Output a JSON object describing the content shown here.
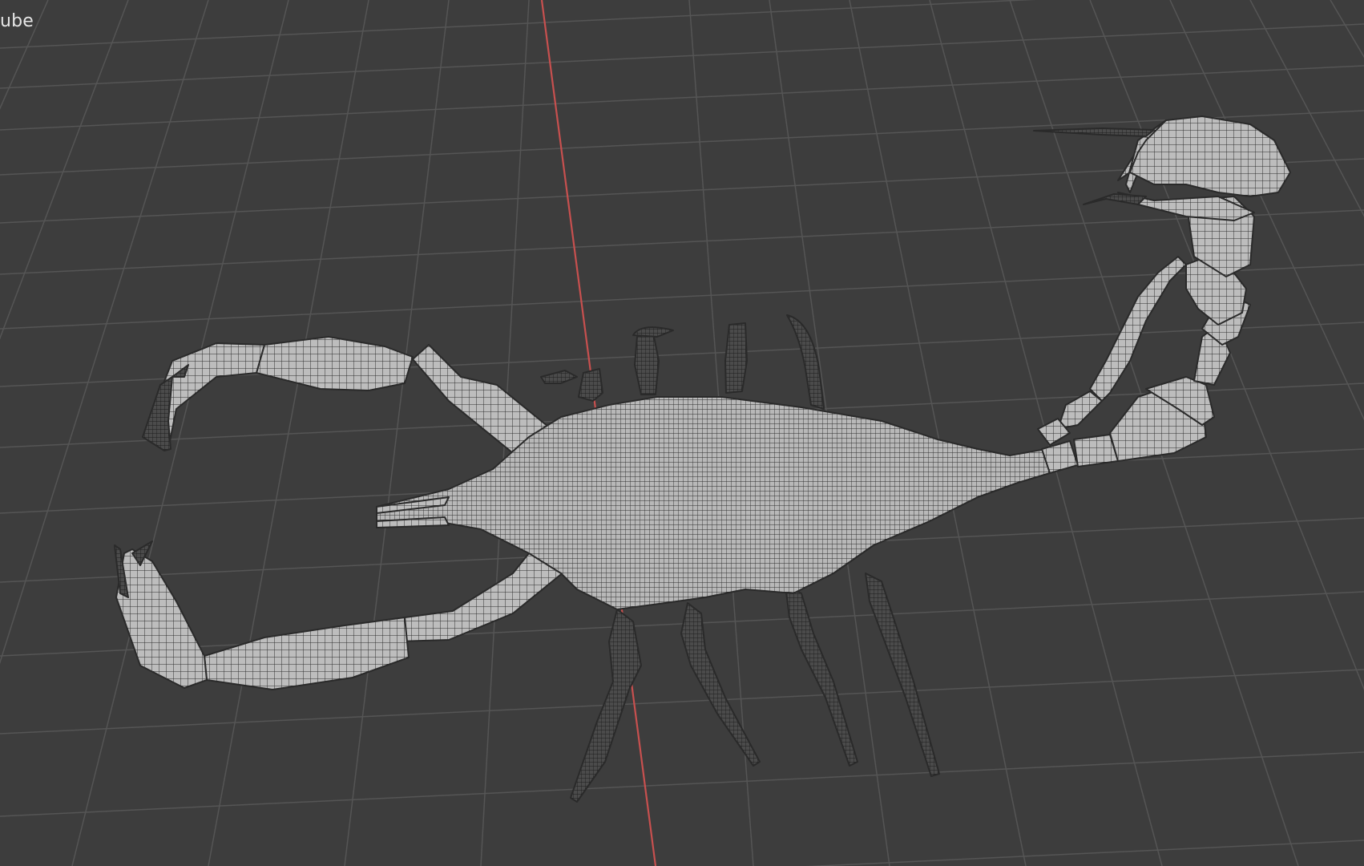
{
  "viewport": {
    "object_name": "ube",
    "colors": {
      "background": "#3d3d3d",
      "grid_line": "#555555",
      "x_axis": "#c8504f",
      "mesh_fill": "#bdbdbd",
      "mesh_wire": "#2e2e2e",
      "mesh_dark": "#2a2a2a"
    },
    "mesh_display": "wireframe-overlay"
  }
}
